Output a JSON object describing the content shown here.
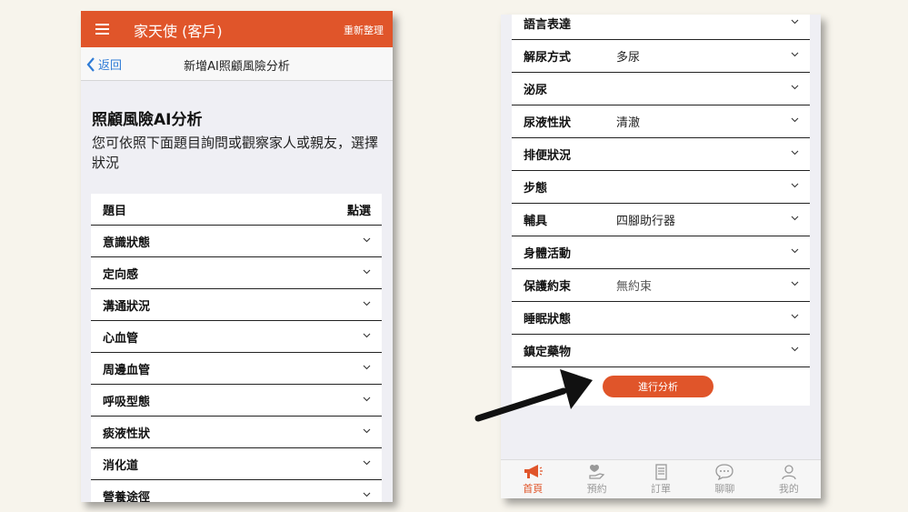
{
  "left": {
    "app_title": "家天使 (客戶)",
    "refresh_label": "重新整理",
    "back_label": "返回",
    "nav_title": "新增AI照顧風險分析",
    "intro_title": "照顧風險AI分析",
    "intro_desc": "您可依照下面題目詢問或觀察家人或親友，選擇狀況",
    "header_col1": "題目",
    "header_col2": "點選",
    "items": [
      {
        "label": "意識狀態"
      },
      {
        "label": "定向感"
      },
      {
        "label": "溝通狀況"
      },
      {
        "label": "心血管"
      },
      {
        "label": "周邊血管"
      },
      {
        "label": "呼吸型態"
      },
      {
        "label": "痰液性狀"
      },
      {
        "label": "消化道"
      },
      {
        "label": "營養途徑"
      }
    ]
  },
  "right": {
    "items": [
      {
        "label": "語言表達",
        "value": ""
      },
      {
        "label": "解尿方式",
        "value": "多尿"
      },
      {
        "label": "泌尿",
        "value": ""
      },
      {
        "label": "尿液性狀",
        "value": "清澈"
      },
      {
        "label": "排便狀況",
        "value": ""
      },
      {
        "label": "步態",
        "value": ""
      },
      {
        "label": "輔具",
        "value": "四腳助行器"
      },
      {
        "label": "身體活動",
        "value": ""
      },
      {
        "label": "保護約束",
        "value": "無約束"
      },
      {
        "label": "睡眠狀態",
        "value": ""
      },
      {
        "label": "鎮定藥物",
        "value": ""
      }
    ],
    "submit_label": "進行分析",
    "tabs": [
      {
        "label": "首頁",
        "icon": "megaphone-icon"
      },
      {
        "label": "預約",
        "icon": "heart-hand-icon"
      },
      {
        "label": "訂單",
        "icon": "document-icon"
      },
      {
        "label": "聊聊",
        "icon": "chat-bubble-icon"
      },
      {
        "label": "我的",
        "icon": "user-icon"
      }
    ]
  },
  "colors": {
    "brand": "#e0552a",
    "link": "#2e7bd6"
  }
}
